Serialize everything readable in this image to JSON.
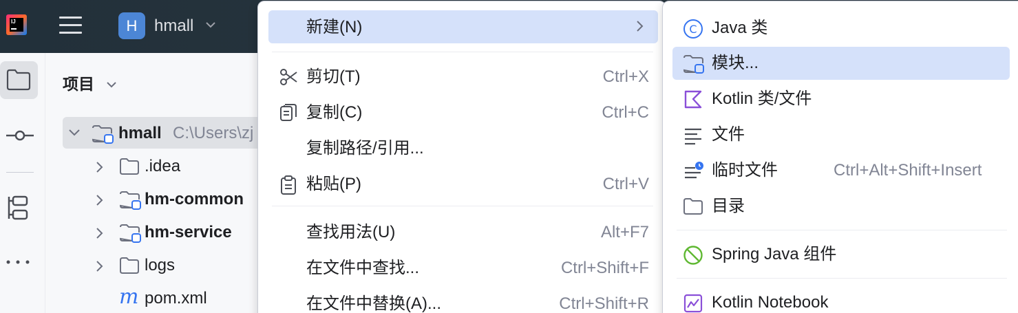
{
  "titlebar": {
    "app_logo_text": "IJ",
    "project_initial": "H",
    "project_name": "hmall"
  },
  "project_panel": {
    "title": "项目",
    "tree": [
      {
        "name": "hmall",
        "path": "C:\\Users\\zj",
        "bold": true,
        "expanded": true,
        "selected": true,
        "icon": "module-folder-icon"
      },
      {
        "name": ".idea",
        "bold": false,
        "icon": "folder-icon"
      },
      {
        "name": "hm-common",
        "bold": true,
        "icon": "module-folder-icon"
      },
      {
        "name": "hm-service",
        "bold": true,
        "icon": "module-folder-icon"
      },
      {
        "name": "logs",
        "bold": false,
        "icon": "folder-icon"
      },
      {
        "name": "pom.xml",
        "bold": false,
        "icon": "maven-icon",
        "icon_glyph": "m"
      }
    ]
  },
  "context_menu": {
    "items": [
      {
        "label": "新建(N)",
        "shortcut": "",
        "submenu": true,
        "highlighted": true
      },
      {
        "label": "剪切(T)",
        "shortcut": "Ctrl+X",
        "icon": "scissors-icon"
      },
      {
        "label": "复制(C)",
        "shortcut": "Ctrl+C",
        "icon": "copy-icon"
      },
      {
        "label": "复制路径/引用...",
        "shortcut": ""
      },
      {
        "label": "粘贴(P)",
        "shortcut": "Ctrl+V",
        "icon": "paste-icon"
      },
      {
        "label": "查找用法(U)",
        "shortcut": "Alt+F7"
      },
      {
        "label": "在文件中查找...",
        "shortcut": "Ctrl+Shift+F"
      },
      {
        "label": "在文件中替换(A)...",
        "shortcut": "Ctrl+Shift+R"
      }
    ]
  },
  "new_submenu": {
    "items": [
      {
        "label": "Java 类",
        "icon": "java-class-icon",
        "icon_glyph": "C"
      },
      {
        "label": "模块...",
        "icon": "module-icon",
        "highlighted": true
      },
      {
        "label": "Kotlin 类/文件",
        "icon": "kotlin-icon"
      },
      {
        "label": "文件",
        "icon": "file-icon"
      },
      {
        "label": "临时文件",
        "shortcut": "Ctrl+Alt+Shift+Insert",
        "icon": "scratch-file-icon"
      },
      {
        "label": "目录",
        "icon": "directory-icon"
      },
      {
        "label": "Spring Java 组件",
        "icon": "spring-icon"
      },
      {
        "label": "Kotlin Notebook",
        "icon": "kotlin-notebook-icon"
      }
    ]
  },
  "colors": {
    "highlight": "#d5e1fa",
    "accent": "#3574f0",
    "titlebar": "#27343d",
    "shortcut": "#818594"
  }
}
